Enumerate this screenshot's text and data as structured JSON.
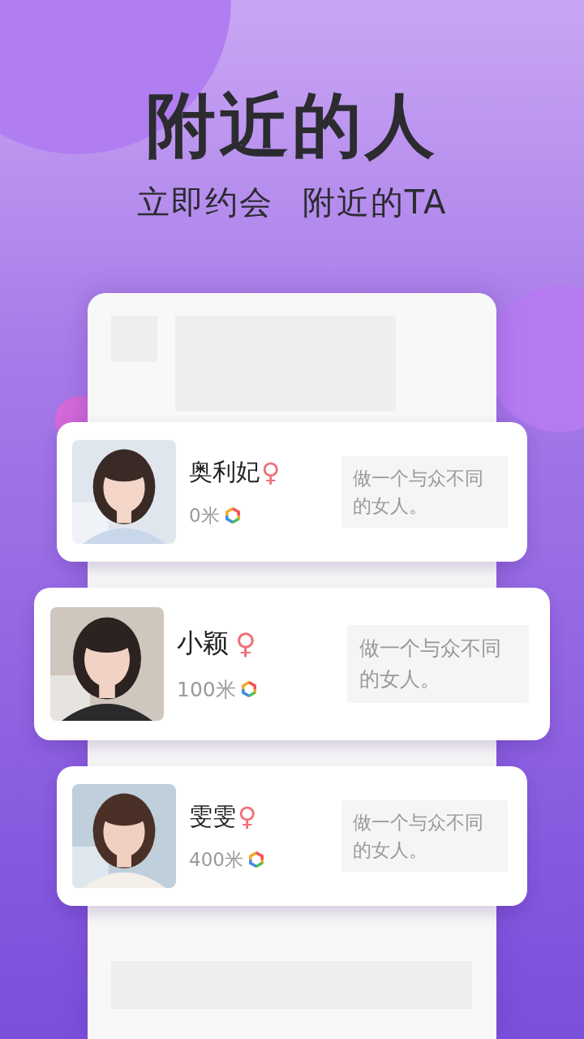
{
  "headline": "附近的人",
  "subheadline": [
    "立即约会",
    "附近的TA"
  ],
  "users": [
    {
      "name": "奥利妃",
      "gender": "♀",
      "distance": "0米",
      "bio": "做一个与众不同的女人。",
      "featured": false
    },
    {
      "name": "小颖",
      "gender": "♀",
      "distance": "100米",
      "bio": "做一个与众不同的女人。",
      "featured": true
    },
    {
      "name": "雯雯",
      "gender": "♀",
      "distance": "400米",
      "bio": "做一个与众不同的女人。",
      "featured": false
    }
  ]
}
